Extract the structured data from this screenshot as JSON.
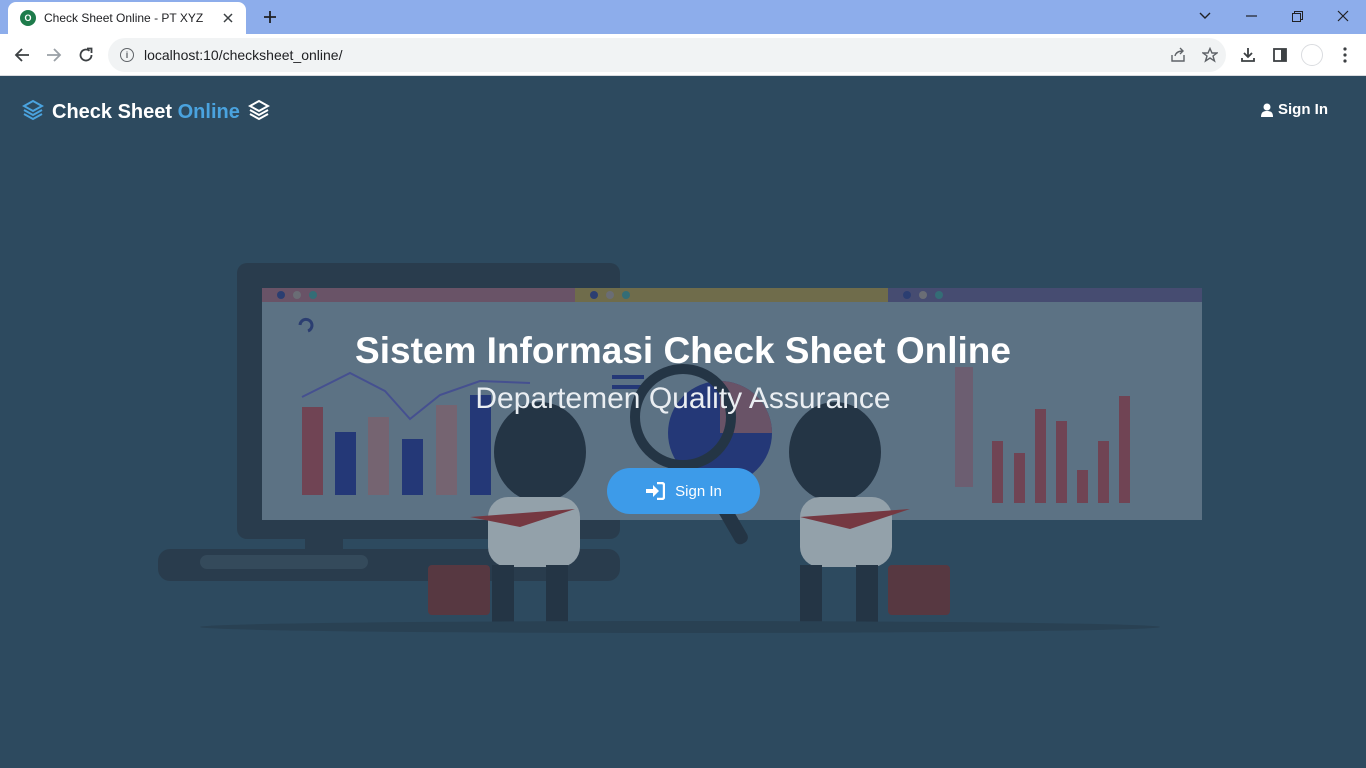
{
  "browser": {
    "tab_title": "Check Sheet Online - PT XYZ",
    "favicon_label": "O",
    "url": "localhost:10/checksheet_online/"
  },
  "navbar": {
    "brand_main": "Check Sheet",
    "brand_accent": "Online",
    "signin_label": "Sign In"
  },
  "hero": {
    "title": "Sistem Informasi Check Sheet Online",
    "subtitle": "Departemen Quality Assurance",
    "button_label": "Sign In"
  },
  "colors": {
    "background": "#2d4a5f",
    "accent": "#4aa3df",
    "button": "#3d9be9",
    "tabbar": "#8dadeb"
  },
  "icons": [
    "layers-icon",
    "user-icon",
    "sign-in-icon",
    "back-icon",
    "forward-icon",
    "reload-icon",
    "info-icon",
    "share-icon",
    "star-icon",
    "download-icon",
    "sidepanel-icon",
    "menu-icon",
    "close-icon",
    "plus-icon",
    "minimize-icon",
    "restore-icon",
    "chevron-down-icon"
  ]
}
